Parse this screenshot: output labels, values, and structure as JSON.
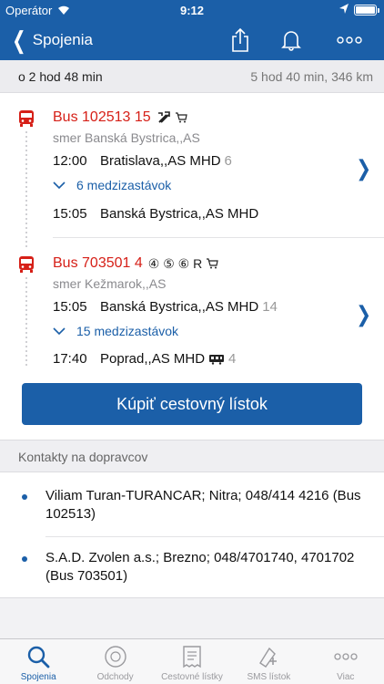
{
  "status_bar": {
    "carrier": "Operátor",
    "time": "9:12"
  },
  "nav": {
    "back_label": "Spojenia"
  },
  "summary": {
    "departure_in": "o 2 hod 48 min",
    "duration_distance": "5 hod 40 min, 346 km"
  },
  "legs": [
    {
      "bus": "Bus 102513 15",
      "extras_text": "",
      "direction": "smer Banská Bystrica,,AS",
      "departure": {
        "time": "12:00",
        "station": "Bratislava,,AS MHD",
        "platform": "6"
      },
      "stops_toggle": "6 medzizastávok",
      "arrival": {
        "time": "15:05",
        "station": "Banská Bystrica,,AS MHD",
        "platform": ""
      }
    },
    {
      "bus": "Bus 703501 4",
      "extras_text": "④ ⑤ ⑥ R",
      "direction": "smer Kežmarok,,AS",
      "departure": {
        "time": "15:05",
        "station": "Banská Bystrica,,AS MHD",
        "platform": "14"
      },
      "stops_toggle": "15 medzizastávok",
      "arrival": {
        "time": "17:40",
        "station": "Poprad,,AS MHD",
        "platform": "4"
      }
    }
  ],
  "buy_button": "Kúpiť cestovný lístok",
  "contacts_header": "Kontakty na dopravcov",
  "contacts": [
    {
      "text": "Viliam Turan-TURANCAR; Nitra; 048/414 4216 (Bus 102513)"
    },
    {
      "text": "S.A.D. Zvolen a.s.; Brezno; 048/4701740, 4701702 (Bus 703501)"
    }
  ],
  "tabs": [
    {
      "label": "Spojenia",
      "icon": "search-icon",
      "active": true
    },
    {
      "label": "Odchody",
      "icon": "clock-icon",
      "active": false
    },
    {
      "label": "Cestovné lístky",
      "icon": "ticket-icon",
      "active": false
    },
    {
      "label": "SMS lístok",
      "icon": "sms-ticket-icon",
      "active": false
    },
    {
      "label": "Viac",
      "icon": "more-icon",
      "active": false
    }
  ],
  "colors": {
    "primary": "#1b5fa8",
    "bus_red": "#d62018"
  }
}
